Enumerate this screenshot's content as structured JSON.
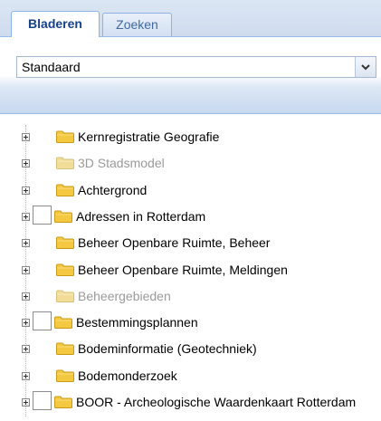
{
  "tabs": [
    {
      "label": "Bladeren",
      "active": true
    },
    {
      "label": "Zoeken",
      "active": false
    }
  ],
  "selector": {
    "value": "Standaard"
  },
  "colors": {
    "folder": "#f5c842",
    "folder_disabled": "#f1dc98",
    "tab_active_text": "#15428b",
    "disabled_text": "#9a9a9a"
  },
  "tree": {
    "items": [
      {
        "label": "Kernregistratie Geografie",
        "disabled": false,
        "checkbox": false
      },
      {
        "label": "3D Stadsmodel",
        "disabled": true,
        "checkbox": false
      },
      {
        "label": "Achtergrond",
        "disabled": false,
        "checkbox": false
      },
      {
        "label": "Adressen in Rotterdam",
        "disabled": false,
        "checkbox": true
      },
      {
        "label": "Beheer Openbare Ruimte, Beheer",
        "disabled": false,
        "checkbox": false
      },
      {
        "label": "Beheer Openbare Ruimte, Meldingen",
        "disabled": false,
        "checkbox": false
      },
      {
        "label": "Beheergebieden",
        "disabled": true,
        "checkbox": false
      },
      {
        "label": "Bestemmingsplannen",
        "disabled": false,
        "checkbox": true
      },
      {
        "label": "Bodeminformatie (Geotechniek)",
        "disabled": false,
        "checkbox": false
      },
      {
        "label": "Bodemonderzoek",
        "disabled": false,
        "checkbox": false
      },
      {
        "label": "BOOR - Archeologische Waardenkaart Rotterdam",
        "disabled": false,
        "checkbox": true
      }
    ]
  }
}
